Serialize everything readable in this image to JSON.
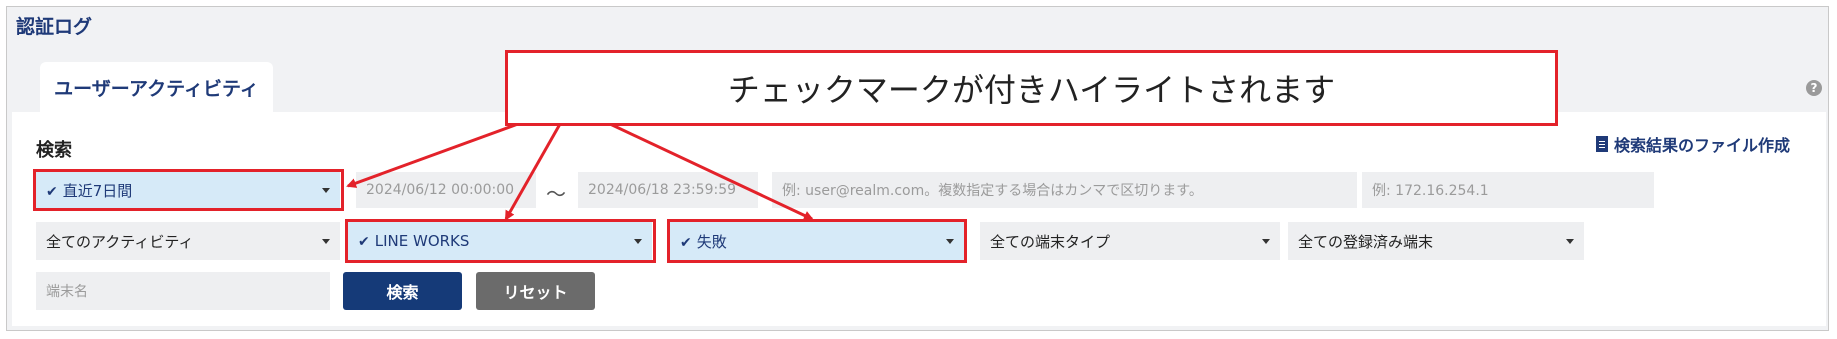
{
  "page": {
    "title": "認証ログ"
  },
  "tabs": [
    {
      "label": "ユーザーアクティビティ",
      "active": true
    }
  ],
  "help_icon": {
    "glyph": "?"
  },
  "search": {
    "title": "検索",
    "export_label": "検索結果のファイル作成",
    "period": {
      "value": "直近7日間",
      "checked": true
    },
    "start_datetime_placeholder": "2024/06/12 00:00:00",
    "range_separator": "～",
    "end_datetime_placeholder": "2024/06/18 23:59:59",
    "user_placeholder": "例: user@realm.com。複数指定する場合はカンマで区切ります。",
    "ip_placeholder": "例: 172.16.254.1",
    "activity": {
      "value": "全てのアクティビティ"
    },
    "service": {
      "value": "LINE WORKS",
      "checked": true
    },
    "result": {
      "value": "失敗",
      "checked": true
    },
    "device_type": {
      "value": "全ての端末タイプ"
    },
    "registered_device": {
      "value": "全ての登録済み端末"
    },
    "device_name_placeholder": "端末名",
    "search_button": "検索",
    "reset_button": "リセット"
  },
  "annotation": {
    "text": "チェックマークが付きハイライトされます",
    "color": "#e3222a"
  },
  "colors": {
    "accent": "#1f3a78",
    "highlight": "#d6eaf8",
    "annotation": "#e3222a"
  }
}
